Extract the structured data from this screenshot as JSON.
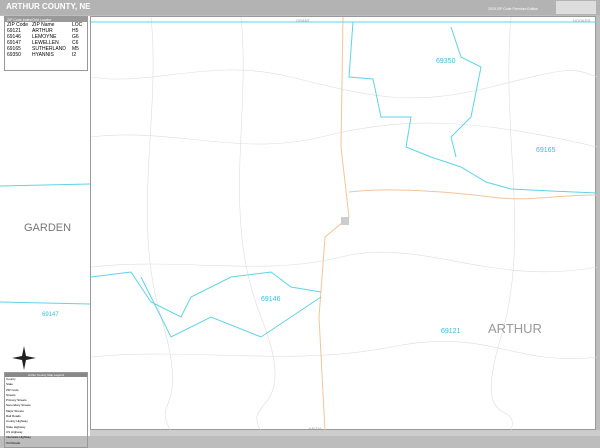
{
  "header": {
    "title": "ARTHUR COUNTY, NE",
    "edition": "2020 ZIP Code Premium Edition"
  },
  "zip_index": {
    "heading": "ZIP Code Index/Grid Locator",
    "columns": [
      "ZIP Code",
      "ZIP Name",
      "LOC"
    ],
    "rows": [
      [
        "69121",
        "ARTHUR",
        "H5"
      ],
      [
        "69146",
        "LEMOYNE",
        "G6"
      ],
      [
        "69147",
        "LEWELLEN",
        "C6"
      ],
      [
        "69165",
        "SUTHERLAND",
        "M5"
      ],
      [
        "69350",
        "HYANNIS",
        "I2"
      ]
    ]
  },
  "legend": {
    "heading": "Arthur County Map Legend",
    "items": [
      "County",
      "State",
      "ZIP Code",
      "Streets",
      "Primary Streets",
      "Secondary Streets",
      "Major Streets",
      "Rail Roads",
      "County Highway",
      "State Highway",
      "US Highway",
      "Interstate Highway",
      "Toll Roads"
    ]
  },
  "map": {
    "neighbors": {
      "north": "GRANT",
      "northeast": "HOOKER",
      "south": "KEITH",
      "west": "GARDEN"
    },
    "county_label": "ARTHUR",
    "zip_labels": [
      "69350",
      "69165",
      "69146",
      "69147",
      "69121"
    ],
    "colors": {
      "zip_boundary": "#5fd3e6",
      "road": "#f2c49a",
      "street": "#d8d8d8"
    }
  }
}
